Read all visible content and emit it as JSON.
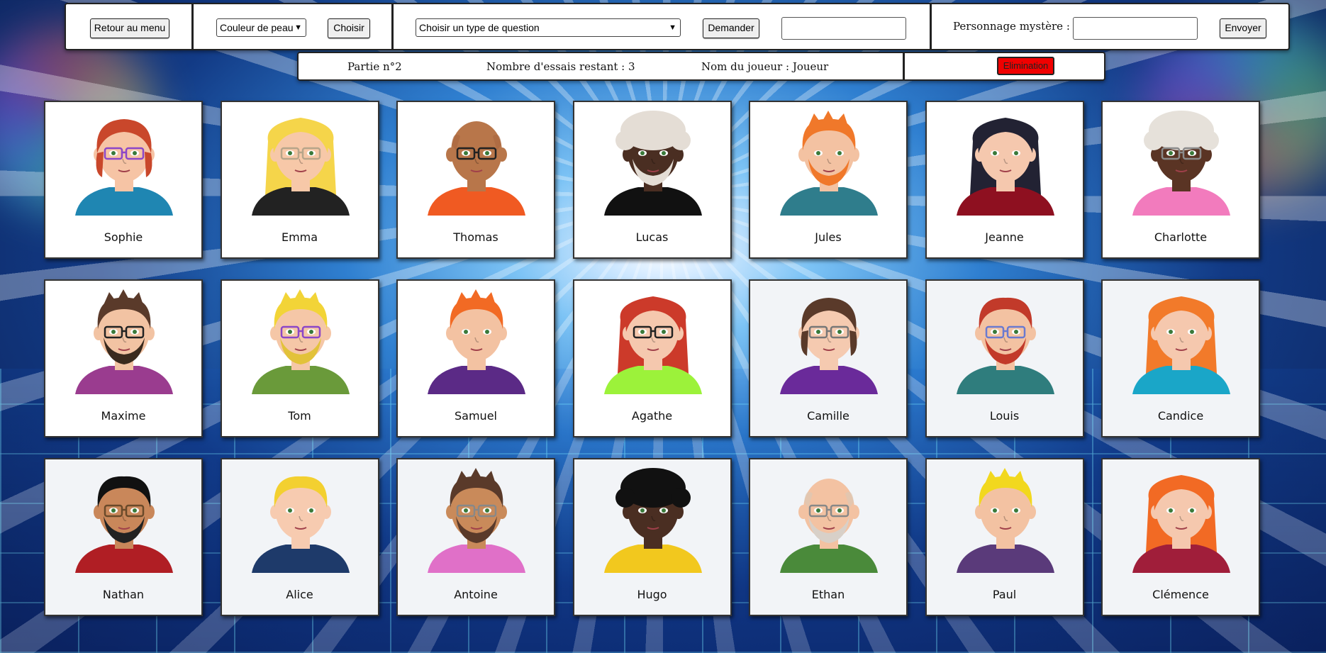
{
  "toolbar": {
    "menu_button": "Retour au menu",
    "attribute_select": "Couleur de peau",
    "choose_button": "Choisir",
    "question_select": "Choisir un type de question",
    "ask_button": "Demander",
    "answer_input": "",
    "mystery_label": "Personnage mystère :",
    "mystery_input": "",
    "send_button": "Envoyer"
  },
  "status": {
    "game": "Partie n°2",
    "tries": "Nombre d'essais restant : 3",
    "player": "Nom du joueur : Joueur",
    "elimination_button": "Elimination"
  },
  "colors": {
    "elimination": "#f00000",
    "card_border": "#333333"
  },
  "characters": [
    {
      "name": "Sophie",
      "skin": "#f6c4a5",
      "hair": "#c9472b",
      "shirt": "#1f86b2",
      "glasses": "#8b46c8",
      "style": "bob",
      "beard": ""
    },
    {
      "name": "Emma",
      "skin": "#f7c8a8",
      "hair": "#f5d54a",
      "shirt": "#222222",
      "glasses": "#b7a58a",
      "style": "long",
      "beard": ""
    },
    {
      "name": "Thomas",
      "skin": "#b8764a",
      "hair": "#a8663f",
      "shirt": "#f05a22",
      "glasses": "#222222",
      "style": "bald",
      "beard": ""
    },
    {
      "name": "Lucas",
      "skin": "#4a2e22",
      "hair": "#e4ddd5",
      "shirt": "#111111",
      "glasses": "",
      "style": "afro",
      "beard": "#e4ddd5"
    },
    {
      "name": "Jules",
      "skin": "#f3c2a2",
      "hair": "#f0782a",
      "shirt": "#2f7d8c",
      "glasses": "",
      "style": "curly",
      "beard": "#f0782a"
    },
    {
      "name": "Jeanne",
      "skin": "#f5c8ae",
      "hair": "#222233",
      "shirt": "#8e1020",
      "glasses": "",
      "style": "long",
      "beard": ""
    },
    {
      "name": "Charlotte",
      "skin": "#5a3424",
      "hair": "#e6e1da",
      "shirt": "#f27bbd",
      "glasses": "#8a8a8a",
      "style": "afro",
      "beard": ""
    },
    {
      "name": "Maxime",
      "skin": "#f2c3a3",
      "hair": "#5a3a2a",
      "shirt": "#9a3c8f",
      "glasses": "#222222",
      "style": "messy",
      "beard": "#3a2a1e"
    },
    {
      "name": "Tom",
      "skin": "#f5c7a7",
      "hair": "#f2d437",
      "shirt": "#6a9a3a",
      "glasses": "#8b46c8",
      "style": "quiff",
      "beard": "#e2c23a"
    },
    {
      "name": "Samuel",
      "skin": "#f3c2a2",
      "hair": "#f26a24",
      "shirt": "#5b2a86",
      "glasses": "",
      "style": "spiky",
      "beard": ""
    },
    {
      "name": "Agathe",
      "skin": "#f5c8ae",
      "hair": "#cc3a2a",
      "shirt": "#9cf23a",
      "glasses": "#222222",
      "style": "long",
      "beard": ""
    },
    {
      "name": "Camille",
      "skin": "#f5cab0",
      "hair": "#5a3a2a",
      "shirt": "#6a2a9a",
      "glasses": "#777777",
      "style": "bob",
      "beard": ""
    },
    {
      "name": "Louis",
      "skin": "#f3c2a2",
      "hair": "#c23a2a",
      "shirt": "#2f7d7d",
      "glasses": "#6a7ad0",
      "style": "short",
      "beard": "#c23a2a"
    },
    {
      "name": "Candice",
      "skin": "#f5c8ae",
      "hair": "#f27a2a",
      "shirt": "#1aa6c8",
      "glasses": "",
      "style": "wavy",
      "beard": ""
    },
    {
      "name": "Nathan",
      "skin": "#c9875a",
      "hair": "#111111",
      "shirt": "#b01e24",
      "glasses": "#6a4a2a",
      "style": "short",
      "beard": "#222222"
    },
    {
      "name": "Alice",
      "skin": "#f7cbb0",
      "hair": "#f3d030",
      "shirt": "#1e3a6a",
      "glasses": "",
      "style": "pixie",
      "beard": ""
    },
    {
      "name": "Antoine",
      "skin": "#c98a5a",
      "hair": "#5a3a2a",
      "shirt": "#e070c8",
      "glasses": "#888888",
      "style": "messy",
      "beard": "#5a3a2a"
    },
    {
      "name": "Hugo",
      "skin": "#4a2e22",
      "hair": "#111111",
      "shirt": "#f2c81e",
      "glasses": "",
      "style": "afro",
      "beard": ""
    },
    {
      "name": "Ethan",
      "skin": "#f3c2a2",
      "hair": "#d8c8b8",
      "shirt": "#4a8a3a",
      "glasses": "#888888",
      "style": "bald",
      "beard": "#d8d0c8"
    },
    {
      "name": "Paul",
      "skin": "#f3c2a2",
      "hair": "#f2d81e",
      "shirt": "#5a3a7a",
      "glasses": "",
      "style": "spiky",
      "beard": ""
    },
    {
      "name": "Clémence",
      "skin": "#f5c8ae",
      "hair": "#f26a24",
      "shirt": "#a01e3a",
      "glasses": "",
      "style": "long",
      "beard": ""
    }
  ]
}
